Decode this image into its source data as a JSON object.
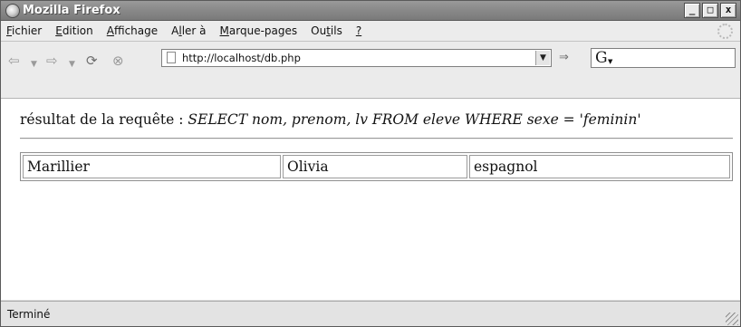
{
  "window": {
    "title": "Mozilla Firefox",
    "controls": {
      "minimize": "_",
      "maximize": "□",
      "close": "x"
    }
  },
  "menubar": {
    "items": [
      "Fichier",
      "Edition",
      "Affichage",
      "Aller à",
      "Marque-pages",
      "Outils",
      "?"
    ]
  },
  "navbar": {
    "url": "http://localhost/db.php",
    "search_engine_icon": "G"
  },
  "content": {
    "label": "résultat de la requête : ",
    "query": "SELECT nom, prenom, lv FROM eleve WHERE sexe = 'feminin'",
    "table": [
      [
        "Marillier",
        "Olivia",
        "espagnol"
      ]
    ]
  },
  "statusbar": {
    "text": "Terminé"
  },
  "icons": {
    "back": "back-arrow-icon",
    "forward": "forward-arrow-icon",
    "reload": "reload-icon",
    "stop": "stop-icon",
    "page": "page-icon",
    "go": "go-icon",
    "throbber": "throbber-icon"
  }
}
